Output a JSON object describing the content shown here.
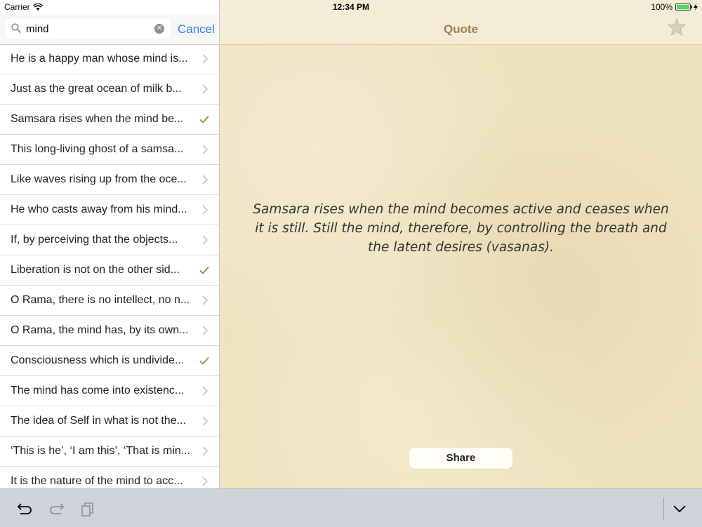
{
  "status_bar": {
    "carrier": "Carrier",
    "time": "12:34 PM",
    "battery": "100%"
  },
  "search": {
    "value": "mind",
    "cancel_label": "Cancel"
  },
  "list": [
    {
      "text": "He is a happy man whose mind is...",
      "accessory": "chevron"
    },
    {
      "text": "Just as the great ocean of milk b...",
      "accessory": "chevron"
    },
    {
      "text": "Samsara rises when the mind be...",
      "accessory": "check"
    },
    {
      "text": "This long-living ghost of a samsa...",
      "accessory": "chevron"
    },
    {
      "text": "Like waves rising up from the oce...",
      "accessory": "chevron"
    },
    {
      "text": "He who casts away from his mind...",
      "accessory": "chevron"
    },
    {
      "text": "If, by perceiving that the objects...",
      "accessory": "chevron"
    },
    {
      "text": "Liberation is not on the other sid...",
      "accessory": "check"
    },
    {
      "text": "O Rama, there is no intellect, no n...",
      "accessory": "chevron"
    },
    {
      "text": "O Rama, the mind has, by its own...",
      "accessory": "chevron"
    },
    {
      "text": "Consciousness which is undivide...",
      "accessory": "check"
    },
    {
      "text": "The mind has come into existenc...",
      "accessory": "chevron"
    },
    {
      "text": "The idea of Self in what is not the...",
      "accessory": "chevron"
    },
    {
      "text": "‘This is he’, ‘I am this’, ‘That is min...",
      "accessory": "chevron"
    },
    {
      "text": "It is the nature of the mind to acc...",
      "accessory": "chevron"
    }
  ],
  "detail": {
    "nav_title": "Quote",
    "quote": "Samsara rises when the mind becomes active and ceases when it is still. Still the mind, therefore, by controlling the breath and the latent desires (vasanas).",
    "share_label": "Share"
  },
  "colors": {
    "accent_blue": "#2f7ff7",
    "check_color": "#a0834e",
    "title_color": "#9a8050"
  }
}
